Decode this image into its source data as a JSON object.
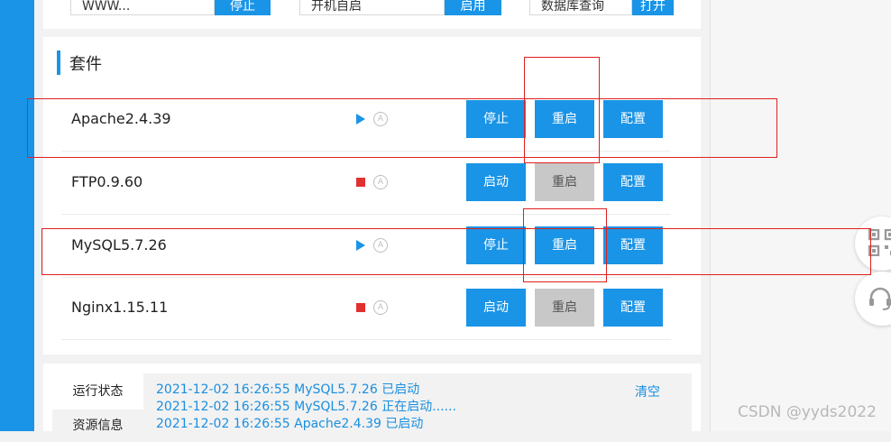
{
  "top_controls": [
    {
      "input": "WWW...",
      "button": "停止"
    },
    {
      "input": "开机自启",
      "button": "启用"
    },
    {
      "input": "数据库查询",
      "button": "打开"
    }
  ],
  "suites": {
    "title": "套件",
    "items": [
      {
        "name": "Apache2.4.39",
        "status": "running",
        "status_icon": "play-icon",
        "auto_label": "A",
        "buttons": [
          {
            "label": "停止",
            "enabled": true
          },
          {
            "label": "重启",
            "enabled": true
          },
          {
            "label": "配置",
            "enabled": true
          }
        ]
      },
      {
        "name": "FTP0.9.60",
        "status": "stopped",
        "status_icon": "stop-square-icon",
        "auto_label": "A",
        "buttons": [
          {
            "label": "启动",
            "enabled": true
          },
          {
            "label": "重启",
            "enabled": false
          },
          {
            "label": "配置",
            "enabled": true
          }
        ]
      },
      {
        "name": "MySQL5.7.26",
        "status": "running",
        "status_icon": "play-icon",
        "auto_label": "A",
        "buttons": [
          {
            "label": "停止",
            "enabled": true
          },
          {
            "label": "重启",
            "enabled": true
          },
          {
            "label": "配置",
            "enabled": true
          }
        ]
      },
      {
        "name": "Nginx1.15.11",
        "status": "stopped",
        "status_icon": "stop-square-icon",
        "auto_label": "A",
        "buttons": [
          {
            "label": "启动",
            "enabled": true
          },
          {
            "label": "重启",
            "enabled": false
          },
          {
            "label": "配置",
            "enabled": true
          }
        ]
      }
    ]
  },
  "log_panel": {
    "tabs": [
      "运行状态",
      "资源信息"
    ],
    "lines": [
      "2021-12-02 16:26:55 MySQL5.7.26 已启动",
      "2021-12-02 16:26:55 MySQL5.7.26 正在启动......",
      "2021-12-02 16:26:55 Apache2.4.39 已启动"
    ],
    "clear_label": "清空"
  },
  "side_buttons": [
    "qrcode-icon",
    "headset-icon"
  ],
  "watermark": "CSDN @yyds2022",
  "colors": {
    "accent": "#1a94e6",
    "stopped": "#e03030",
    "disabled": "#c8c8c8",
    "annotation": "#e02020",
    "link": "#1a8fe0"
  }
}
